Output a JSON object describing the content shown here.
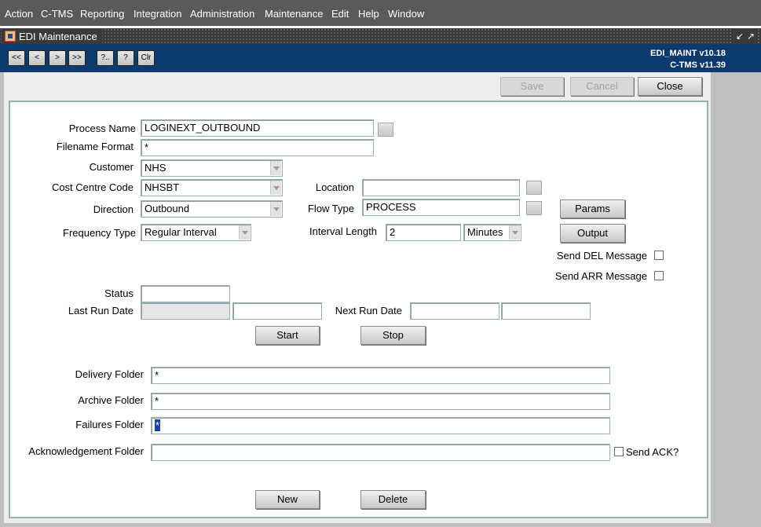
{
  "menu": [
    {
      "label": "Action"
    },
    {
      "label": "C-TMS"
    },
    {
      "label": "Reporting"
    },
    {
      "label": "Integration"
    },
    {
      "label": "Administration"
    },
    {
      "label": "Maintenance"
    },
    {
      "label": "Edit"
    },
    {
      "label": "Help"
    },
    {
      "label": "Window"
    }
  ],
  "window": {
    "title": "EDI Maintenance",
    "icon": "app-form-icon",
    "controls": {
      "minimize": "↙",
      "maximize": "↗"
    }
  },
  "toolbar": {
    "nav": [
      "<<",
      "<",
      ">",
      ">>"
    ],
    "query": [
      "?..",
      "?",
      "Clr"
    ],
    "version_line1": "EDI_MAINT v10.18",
    "version_line2": "C-TMS v11.39"
  },
  "actions": {
    "save": "Save",
    "cancel": "Cancel",
    "close": "Close"
  },
  "form": {
    "process_name": {
      "label": "Process Name",
      "value": "LOGINEXT_OUTBOUND"
    },
    "filename_format": {
      "label": "Filename Format",
      "value": "*"
    },
    "customer": {
      "label": "Customer",
      "value": "NHS"
    },
    "cost_centre": {
      "label": "Cost Centre Code",
      "value": "NHSBT"
    },
    "direction": {
      "label": "Direction",
      "value": "Outbound"
    },
    "frequency_type": {
      "label": "Frequency Type",
      "value": "Regular Interval"
    },
    "location": {
      "label": "Location",
      "value": ""
    },
    "flow_type": {
      "label": "Flow Type",
      "value": "PROCESS"
    },
    "interval_length": {
      "label": "Interval Length",
      "value": "2",
      "unit": "Minutes"
    },
    "params_button": "Params",
    "output_button": "Output",
    "send_del": {
      "label": "Send DEL Message",
      "checked": false
    },
    "send_arr": {
      "label": "Send ARR Message",
      "checked": false
    },
    "status": {
      "label": "Status",
      "value": ""
    },
    "last_run_date": {
      "label": "Last Run Date",
      "value": "",
      "value2": ""
    },
    "next_run_date": {
      "label": "Next Run Date",
      "value": "",
      "value2": ""
    },
    "start_button": "Start",
    "stop_button": "Stop",
    "delivery_folder": {
      "label": "Delivery Folder",
      "value": "*"
    },
    "archive_folder": {
      "label": "Archive Folder",
      "value": "*"
    },
    "failures_folder": {
      "label": "Failures Folder",
      "value": "*"
    },
    "ack_folder": {
      "label": "Acknowledgement Folder",
      "value": ""
    },
    "send_ack": {
      "label": "Send ACK?",
      "checked": false
    },
    "new_button": "New",
    "delete_button": "Delete"
  }
}
